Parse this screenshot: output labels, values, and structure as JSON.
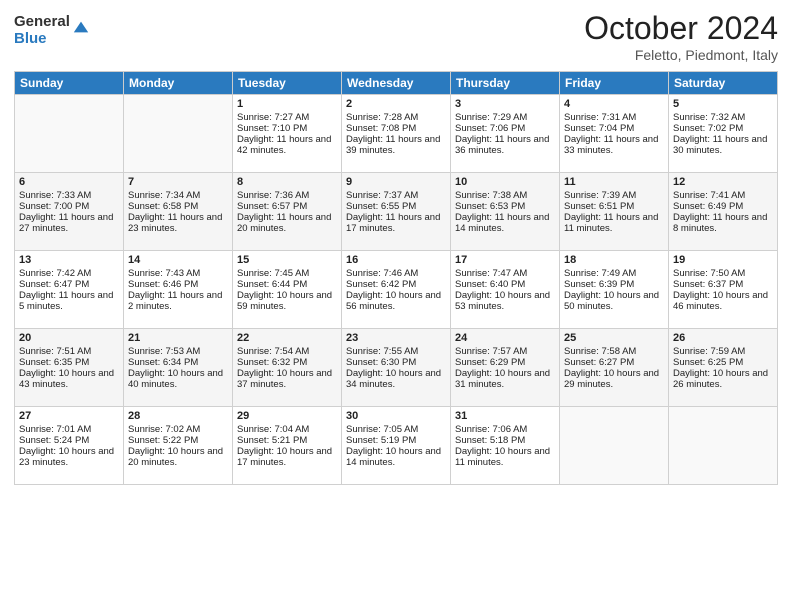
{
  "header": {
    "logo_general": "General",
    "logo_blue": "Blue",
    "title": "October 2024",
    "location": "Feletto, Piedmont, Italy"
  },
  "days_of_week": [
    "Sunday",
    "Monday",
    "Tuesday",
    "Wednesday",
    "Thursday",
    "Friday",
    "Saturday"
  ],
  "weeks": [
    [
      {
        "day": "",
        "info": ""
      },
      {
        "day": "",
        "info": ""
      },
      {
        "day": "1",
        "info": "Sunrise: 7:27 AM\nSunset: 7:10 PM\nDaylight: 11 hours and 42 minutes."
      },
      {
        "day": "2",
        "info": "Sunrise: 7:28 AM\nSunset: 7:08 PM\nDaylight: 11 hours and 39 minutes."
      },
      {
        "day": "3",
        "info": "Sunrise: 7:29 AM\nSunset: 7:06 PM\nDaylight: 11 hours and 36 minutes."
      },
      {
        "day": "4",
        "info": "Sunrise: 7:31 AM\nSunset: 7:04 PM\nDaylight: 11 hours and 33 minutes."
      },
      {
        "day": "5",
        "info": "Sunrise: 7:32 AM\nSunset: 7:02 PM\nDaylight: 11 hours and 30 minutes."
      }
    ],
    [
      {
        "day": "6",
        "info": "Sunrise: 7:33 AM\nSunset: 7:00 PM\nDaylight: 11 hours and 27 minutes."
      },
      {
        "day": "7",
        "info": "Sunrise: 7:34 AM\nSunset: 6:58 PM\nDaylight: 11 hours and 23 minutes."
      },
      {
        "day": "8",
        "info": "Sunrise: 7:36 AM\nSunset: 6:57 PM\nDaylight: 11 hours and 20 minutes."
      },
      {
        "day": "9",
        "info": "Sunrise: 7:37 AM\nSunset: 6:55 PM\nDaylight: 11 hours and 17 minutes."
      },
      {
        "day": "10",
        "info": "Sunrise: 7:38 AM\nSunset: 6:53 PM\nDaylight: 11 hours and 14 minutes."
      },
      {
        "day": "11",
        "info": "Sunrise: 7:39 AM\nSunset: 6:51 PM\nDaylight: 11 hours and 11 minutes."
      },
      {
        "day": "12",
        "info": "Sunrise: 7:41 AM\nSunset: 6:49 PM\nDaylight: 11 hours and 8 minutes."
      }
    ],
    [
      {
        "day": "13",
        "info": "Sunrise: 7:42 AM\nSunset: 6:47 PM\nDaylight: 11 hours and 5 minutes."
      },
      {
        "day": "14",
        "info": "Sunrise: 7:43 AM\nSunset: 6:46 PM\nDaylight: 11 hours and 2 minutes."
      },
      {
        "day": "15",
        "info": "Sunrise: 7:45 AM\nSunset: 6:44 PM\nDaylight: 10 hours and 59 minutes."
      },
      {
        "day": "16",
        "info": "Sunrise: 7:46 AM\nSunset: 6:42 PM\nDaylight: 10 hours and 56 minutes."
      },
      {
        "day": "17",
        "info": "Sunrise: 7:47 AM\nSunset: 6:40 PM\nDaylight: 10 hours and 53 minutes."
      },
      {
        "day": "18",
        "info": "Sunrise: 7:49 AM\nSunset: 6:39 PM\nDaylight: 10 hours and 50 minutes."
      },
      {
        "day": "19",
        "info": "Sunrise: 7:50 AM\nSunset: 6:37 PM\nDaylight: 10 hours and 46 minutes."
      }
    ],
    [
      {
        "day": "20",
        "info": "Sunrise: 7:51 AM\nSunset: 6:35 PM\nDaylight: 10 hours and 43 minutes."
      },
      {
        "day": "21",
        "info": "Sunrise: 7:53 AM\nSunset: 6:34 PM\nDaylight: 10 hours and 40 minutes."
      },
      {
        "day": "22",
        "info": "Sunrise: 7:54 AM\nSunset: 6:32 PM\nDaylight: 10 hours and 37 minutes."
      },
      {
        "day": "23",
        "info": "Sunrise: 7:55 AM\nSunset: 6:30 PM\nDaylight: 10 hours and 34 minutes."
      },
      {
        "day": "24",
        "info": "Sunrise: 7:57 AM\nSunset: 6:29 PM\nDaylight: 10 hours and 31 minutes."
      },
      {
        "day": "25",
        "info": "Sunrise: 7:58 AM\nSunset: 6:27 PM\nDaylight: 10 hours and 29 minutes."
      },
      {
        "day": "26",
        "info": "Sunrise: 7:59 AM\nSunset: 6:25 PM\nDaylight: 10 hours and 26 minutes."
      }
    ],
    [
      {
        "day": "27",
        "info": "Sunrise: 7:01 AM\nSunset: 5:24 PM\nDaylight: 10 hours and 23 minutes."
      },
      {
        "day": "28",
        "info": "Sunrise: 7:02 AM\nSunset: 5:22 PM\nDaylight: 10 hours and 20 minutes."
      },
      {
        "day": "29",
        "info": "Sunrise: 7:04 AM\nSunset: 5:21 PM\nDaylight: 10 hours and 17 minutes."
      },
      {
        "day": "30",
        "info": "Sunrise: 7:05 AM\nSunset: 5:19 PM\nDaylight: 10 hours and 14 minutes."
      },
      {
        "day": "31",
        "info": "Sunrise: 7:06 AM\nSunset: 5:18 PM\nDaylight: 10 hours and 11 minutes."
      },
      {
        "day": "",
        "info": ""
      },
      {
        "day": "",
        "info": ""
      }
    ]
  ]
}
